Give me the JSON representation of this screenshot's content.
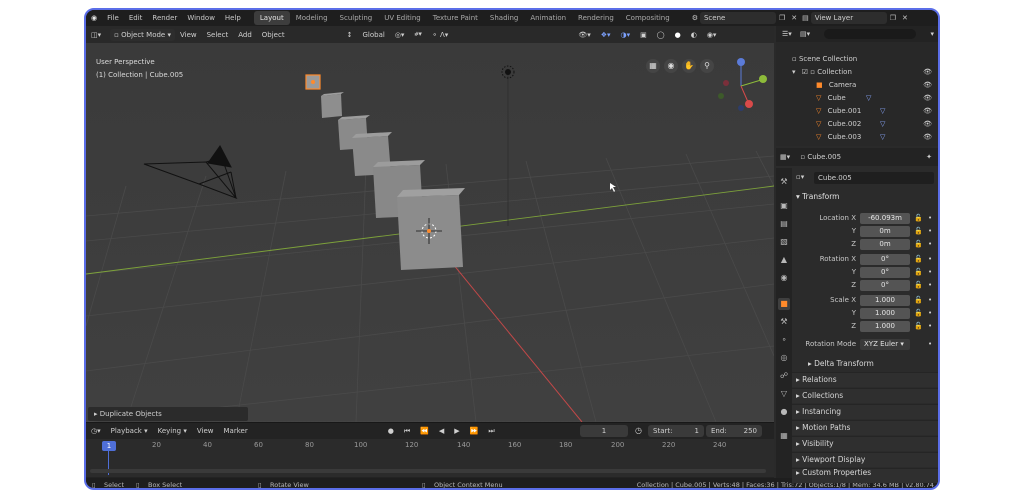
{
  "topbar": {
    "menus": [
      "File",
      "Edit",
      "Render",
      "Window",
      "Help"
    ],
    "workspaces": [
      "Layout",
      "Modeling",
      "Sculpting",
      "UV Editing",
      "Texture Paint",
      "Shading",
      "Animation",
      "Rendering",
      "Compositing"
    ],
    "active_workspace": "Layout",
    "scene": "Scene",
    "view_layer": "View Layer"
  },
  "viewport": {
    "mode": "Object Mode",
    "menus": [
      "View",
      "Select",
      "Add",
      "Object"
    ],
    "orientation": "Global",
    "perspective_label": "User Perspective",
    "collection_label": "(1) Collection | Cube.005",
    "last_operator": "Duplicate Objects"
  },
  "timeline": {
    "menus": [
      "Playback",
      "Keying",
      "View",
      "Marker"
    ],
    "current_frame": "1",
    "start_label": "Start:",
    "start": "1",
    "end_label": "End:",
    "end": "250",
    "ticks": [
      "20",
      "40",
      "60",
      "80",
      "100",
      "120",
      "140",
      "160",
      "180",
      "200",
      "220",
      "240"
    ],
    "playhead": "1"
  },
  "statusbar": {
    "select": "Select",
    "box_select": "Box Select",
    "rotate_view": "Rotate View",
    "context_menu": "Object Context Menu",
    "stats": "Collection | Cube.005 | Verts:48 | Faces:36 | Tris:72 | Objects:1/8 | Mem: 34.6 MB | v2.80.74"
  },
  "outliner": {
    "title": "Scene Collection",
    "collection": "Collection",
    "items": [
      "Camera",
      "Cube",
      "Cube.001",
      "Cube.002",
      "Cube.003"
    ]
  },
  "properties": {
    "object_name": "Cube.005",
    "object_name_field": "Cube.005",
    "transform_title": "Transform",
    "location_label": "Location X",
    "location": [
      "-60.093m",
      "0m",
      "0m"
    ],
    "rotation_label": "Rotation X",
    "rotation": [
      "0°",
      "0°",
      "0°"
    ],
    "scale_label": "Scale X",
    "scale": [
      "1.000",
      "1.000",
      "1.000"
    ],
    "axis_y": "Y",
    "axis_z": "Z",
    "rotation_mode_label": "Rotation Mode",
    "rotation_mode": "XYZ Euler",
    "delta_transform": "Delta Transform",
    "sections": [
      "Relations",
      "Collections",
      "Instancing",
      "Motion Paths",
      "Visibility",
      "Viewport Display",
      "Custom Properties"
    ]
  },
  "colors": {
    "accent": "#5b6ee8",
    "selected_orange": "#ff8a2b",
    "x_axis": "#d84a4a",
    "y_axis": "#8dbb3a"
  }
}
